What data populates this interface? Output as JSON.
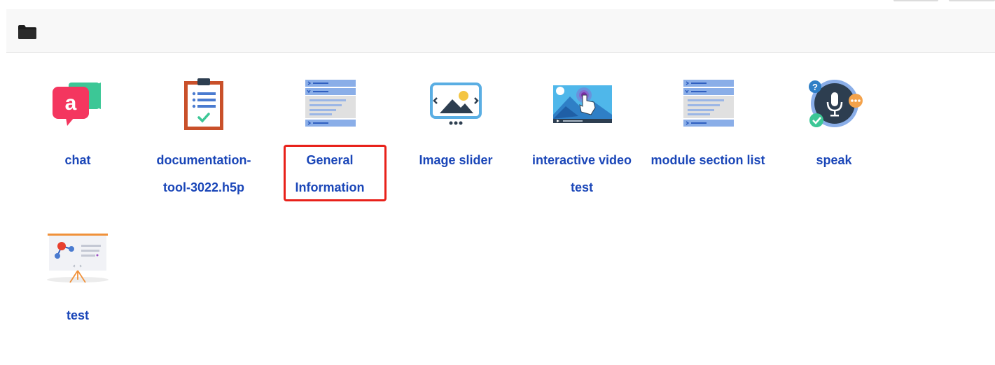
{
  "topbar": {
    "icon": "folder-icon"
  },
  "colors": {
    "label": "#1a46b8",
    "selection_border": "#e8211a",
    "toolbar_bg": "#f8f8f8"
  },
  "items": [
    {
      "label": "chat",
      "icon": "chat-icon"
    },
    {
      "label": "documentation-tool-3022.h5p",
      "icon": "clipboard-checklist-icon"
    },
    {
      "label": "General Information",
      "icon": "accordion-list-icon",
      "selected": true
    },
    {
      "label": "Image slider",
      "icon": "image-slider-icon"
    },
    {
      "label": "interactive video test",
      "icon": "interactive-video-icon"
    },
    {
      "label": "module section list",
      "icon": "accordion-list-icon"
    },
    {
      "label": "speak",
      "icon": "microphone-speech-icon"
    },
    {
      "label": "test",
      "icon": "presentation-board-icon"
    }
  ]
}
